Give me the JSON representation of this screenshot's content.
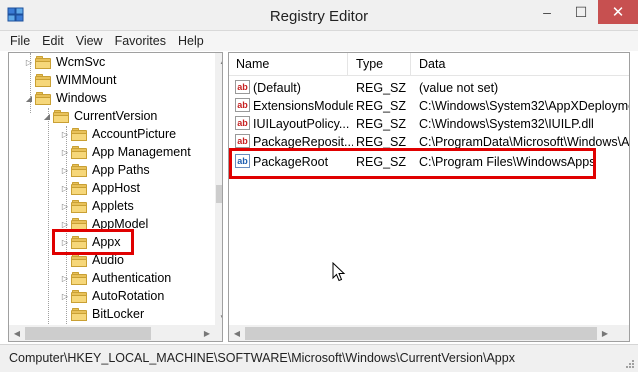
{
  "window": {
    "title": "Registry Editor",
    "buttons": {
      "minimize": "–",
      "maximize": "☐",
      "close": "✕"
    }
  },
  "menu": [
    "File",
    "Edit",
    "View",
    "Favorites",
    "Help"
  ],
  "tree": {
    "items": [
      {
        "label": "WcmSvc",
        "expanded": false
      },
      {
        "label": "WIMMount",
        "expanded": false
      },
      {
        "label": "Windows",
        "expanded": true
      },
      {
        "label": "CurrentVersion",
        "expanded": true
      },
      {
        "label": "AccountPicture",
        "expanded": false
      },
      {
        "label": "App Management",
        "expanded": false
      },
      {
        "label": "App Paths",
        "expanded": false
      },
      {
        "label": "AppHost",
        "expanded": false
      },
      {
        "label": "Applets",
        "expanded": false
      },
      {
        "label": "AppModel",
        "expanded": false
      },
      {
        "label": "Appx",
        "expanded": false,
        "selected": true
      },
      {
        "label": "Audio",
        "expanded": false
      },
      {
        "label": "Authentication",
        "expanded": false
      },
      {
        "label": "AutoRotation",
        "expanded": false
      },
      {
        "label": "BitLocker",
        "expanded": false
      }
    ]
  },
  "list": {
    "columns": [
      "Name",
      "Type",
      "Data"
    ],
    "rows": [
      {
        "name": "(Default)",
        "type": "REG_SZ",
        "data": "(value not set)"
      },
      {
        "name": "ExtensionsModule",
        "type": "REG_SZ",
        "data": "C:\\Windows\\System32\\AppXDeployme"
      },
      {
        "name": "IUILayoutPolicy...",
        "type": "REG_SZ",
        "data": "C:\\Windows\\System32\\IUILP.dll"
      },
      {
        "name": "PackageReposit...",
        "type": "REG_SZ",
        "data": "C:\\ProgramData\\Microsoft\\Windows\\A"
      },
      {
        "name": "PackageRoot",
        "type": "REG_SZ",
        "data": "C:\\Program Files\\WindowsApps",
        "highlighted": true
      }
    ],
    "value_icon_text": "ab"
  },
  "status": {
    "path": "Computer\\HKEY_LOCAL_MACHINE\\SOFTWARE\\Microsoft\\Windows\\CurrentVersion\\Appx"
  },
  "colors": {
    "highlight": "#e00000",
    "folder": "#e8c15a",
    "close_button": "#c75050"
  }
}
